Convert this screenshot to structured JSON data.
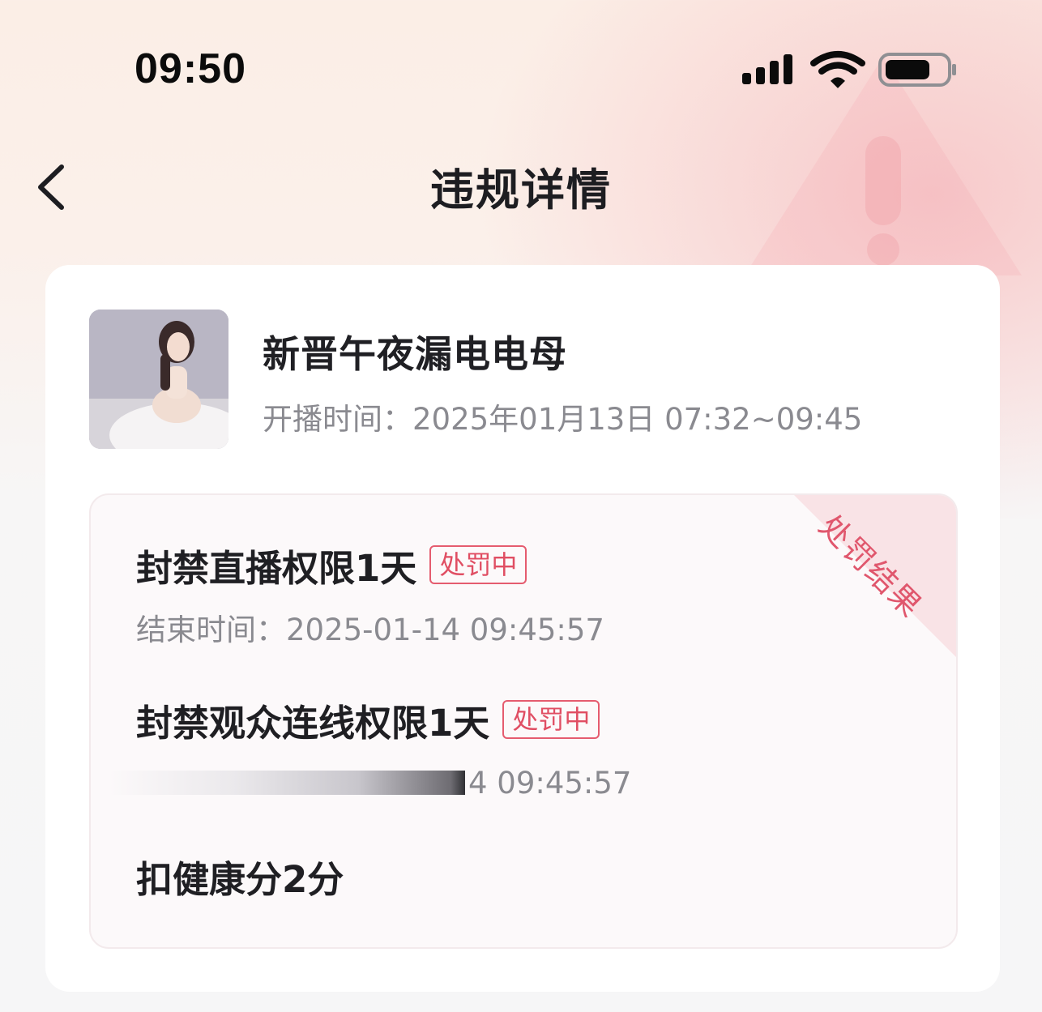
{
  "status_bar": {
    "time": "09:50"
  },
  "nav": {
    "title": "违规详情"
  },
  "streamer": {
    "name": "新晋午夜漏电电母",
    "live_time": "开播时间：2025年01月13日 07:32~09:45"
  },
  "result_section": {
    "ribbon_label": "处罚结果",
    "penalties": [
      {
        "title": "封禁直播权限1天",
        "status": "处罚中",
        "end_time": "结束时间：2025-01-14 09:45:57"
      },
      {
        "title": "封禁观众连线权限1天",
        "status": "处罚中",
        "end_time_visible": "4 09:45:57"
      },
      {
        "title": "扣健康分2分"
      }
    ]
  },
  "colors": {
    "accent_red": "#e04e63",
    "text_primary": "#1f1f23",
    "text_secondary": "#8a8a90"
  }
}
